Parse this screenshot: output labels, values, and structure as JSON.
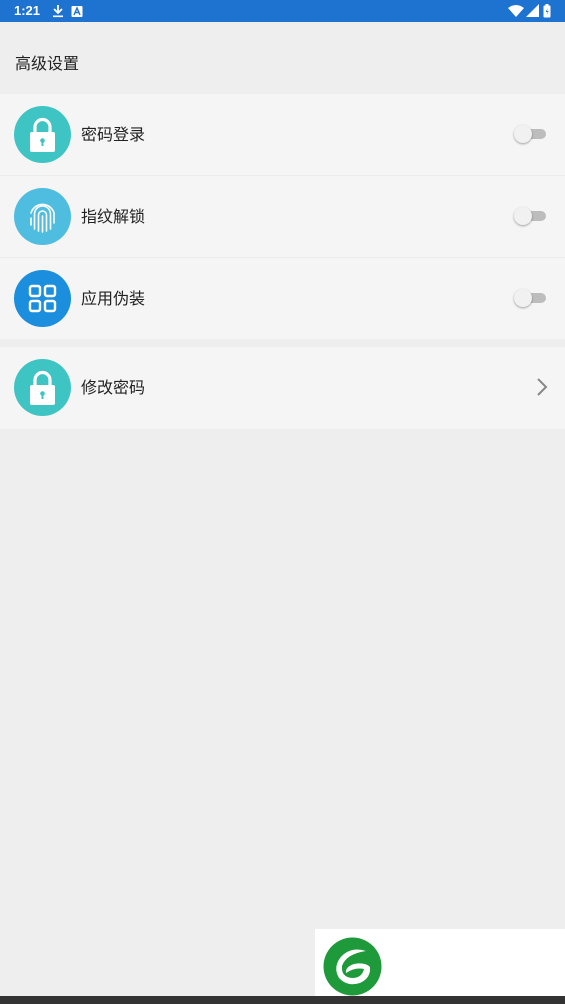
{
  "status_bar": {
    "time": "1:21",
    "icons_left": [
      "download-icon",
      "a-icon"
    ],
    "icons_right": [
      "wifi-icon",
      "signal-icon",
      "battery-icon"
    ],
    "background": "#1e72d0"
  },
  "header": {
    "title": "高级设置"
  },
  "settings": [
    {
      "label": "密码登录",
      "icon": "lock-icon",
      "icon_color": "#3fc4c4",
      "control": "toggle",
      "enabled": false
    },
    {
      "label": "指纹解锁",
      "icon": "fingerprint-icon",
      "icon_color": "#4fbde0",
      "control": "toggle",
      "enabled": false
    },
    {
      "label": "应用伪装",
      "icon": "grid-icon",
      "icon_color": "#1b8fde",
      "control": "toggle",
      "enabled": false
    }
  ],
  "actions": [
    {
      "label": "修改密码",
      "icon": "lock-icon",
      "icon_color": "#3fc4c4",
      "control": "chevron"
    }
  ],
  "watermark": {
    "icon": "leaf-logo-icon",
    "color": "#1f9a3a"
  }
}
